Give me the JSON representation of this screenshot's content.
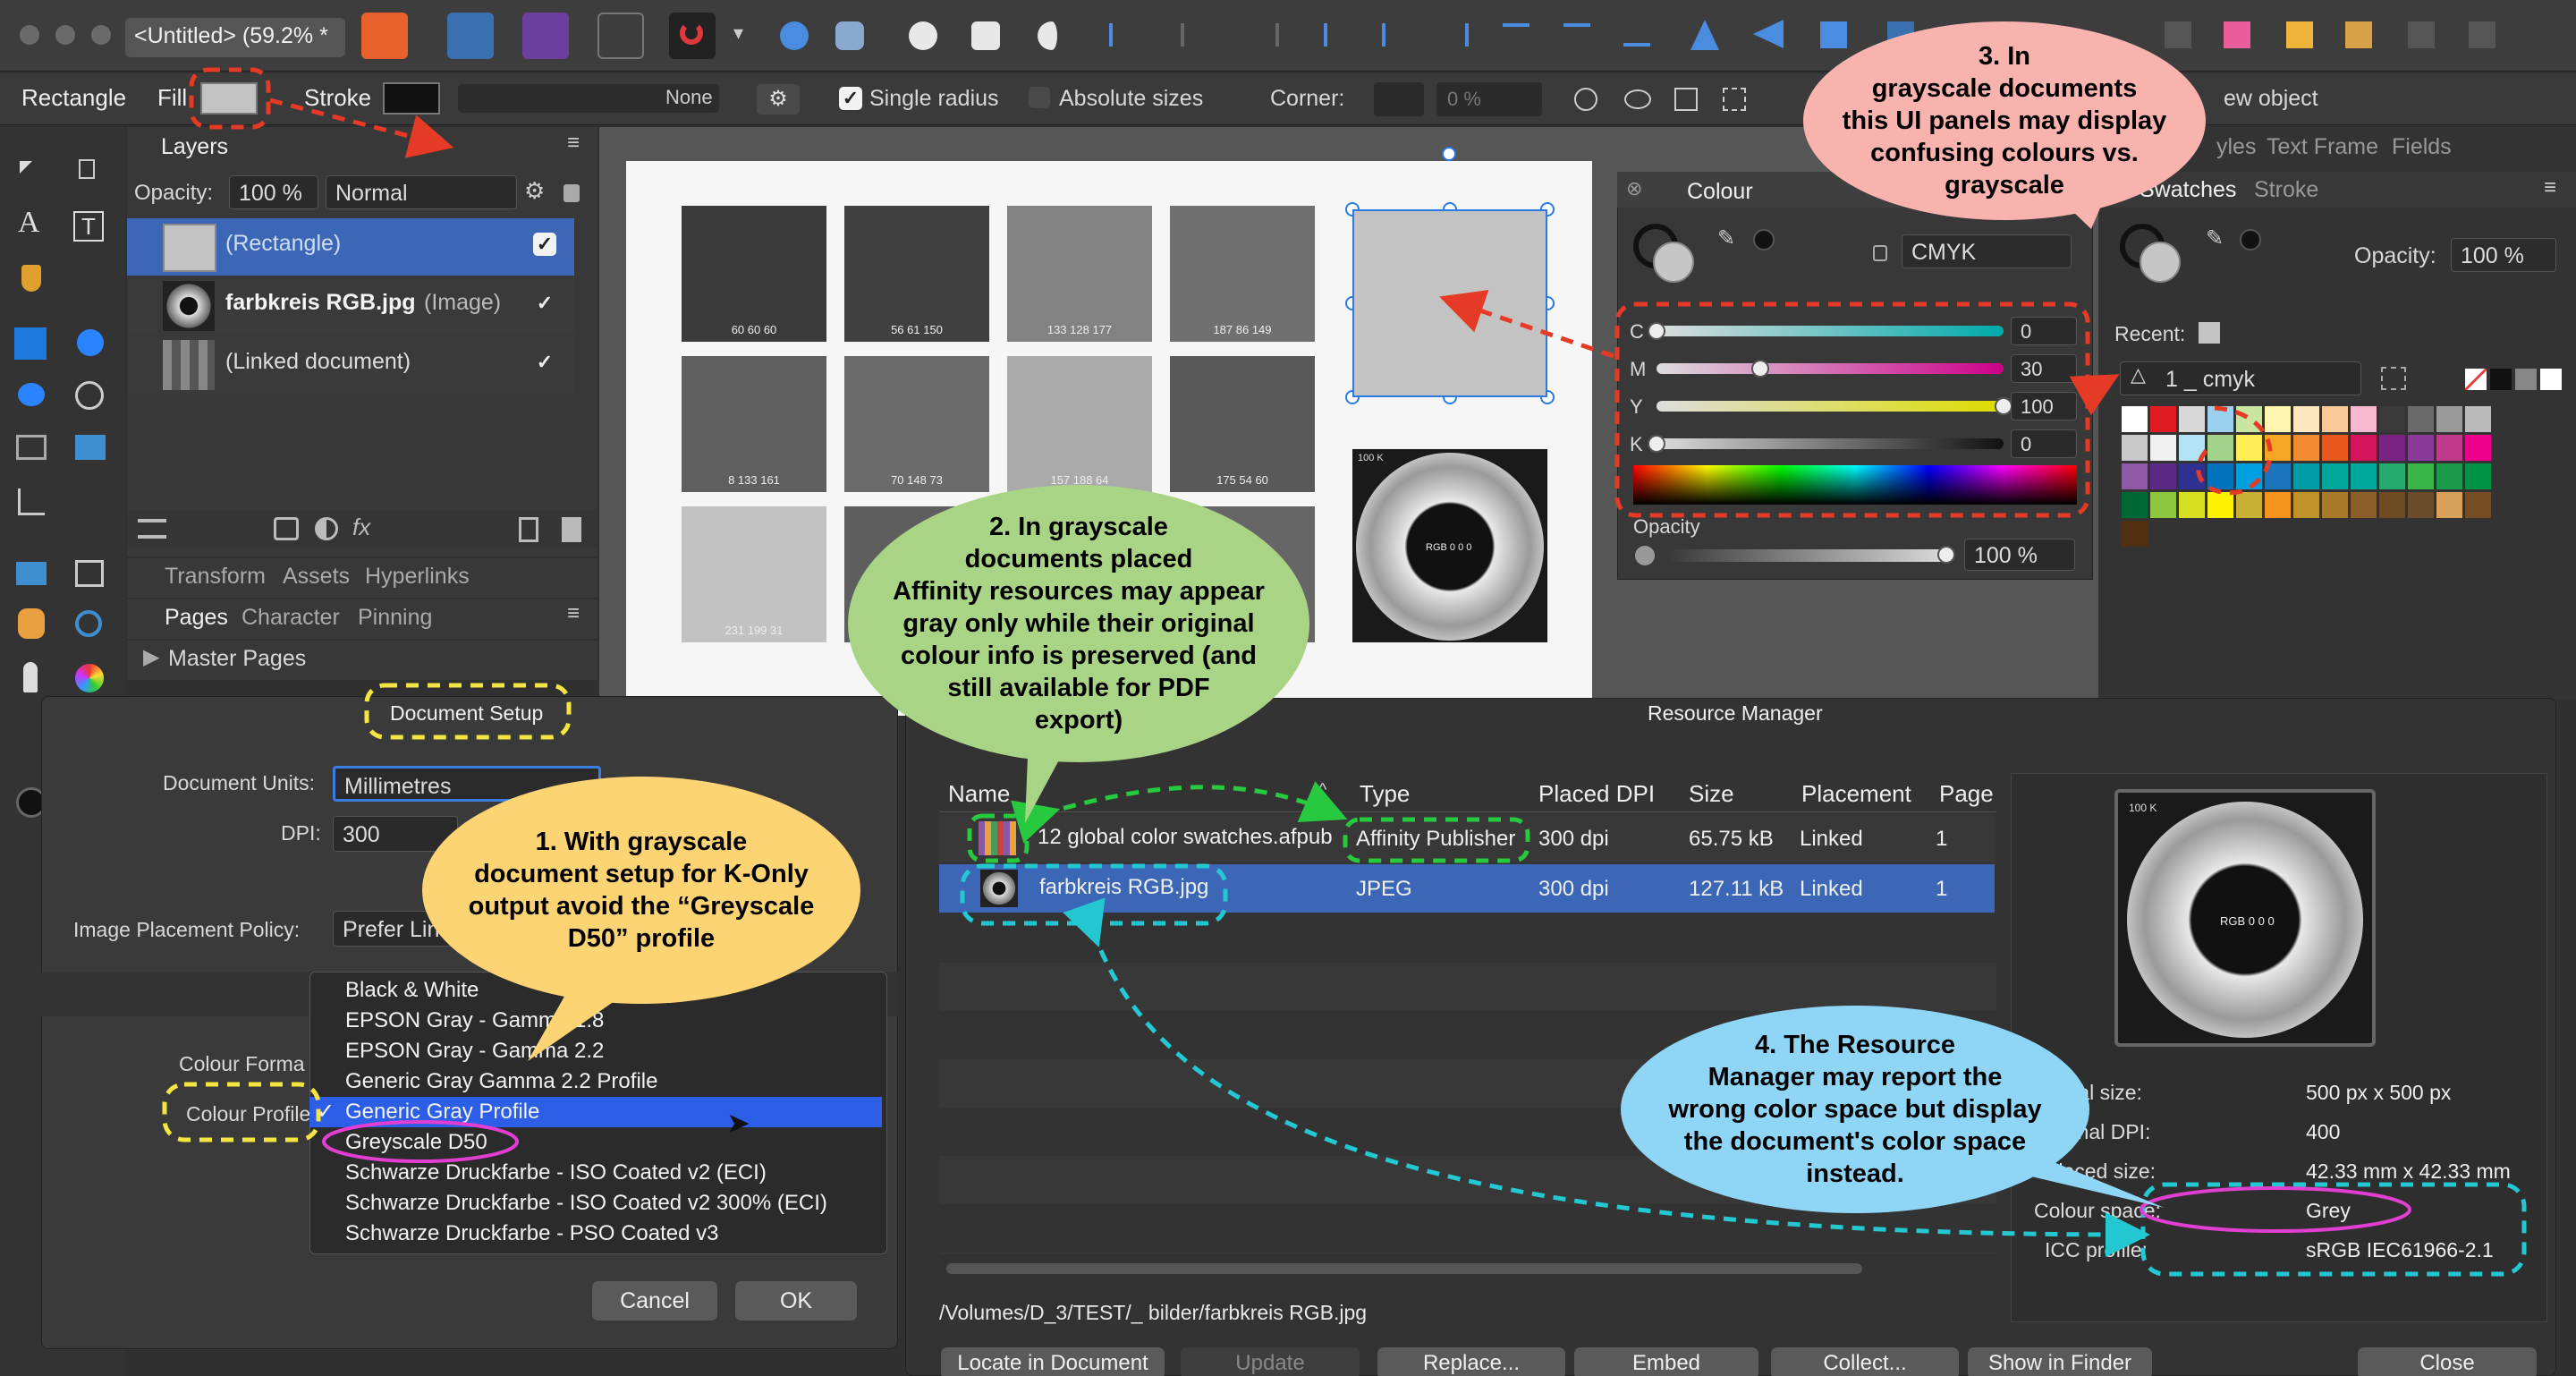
{
  "app": {
    "doc_tab": "<Untitled> (59.2% *"
  },
  "context": {
    "tool_name": "Rectangle",
    "fill_label": "Fill",
    "stroke_label": "Stroke",
    "stroke_none": "None",
    "single_radius": "Single radius",
    "absolute_sizes": "Absolute sizes",
    "corner_label": "Corner:",
    "corner_value": "0 %",
    "new_object": "ew object"
  },
  "layers": {
    "title": "Layers",
    "opacity_label": "Opacity:",
    "opacity_value": "100 %",
    "blend": "Normal",
    "items": [
      {
        "name": "(Rectangle)",
        "type": ""
      },
      {
        "name": "farbkreis RGB.jpg",
        "type": "(Image)"
      },
      {
        "name": "(Linked document)",
        "type": ""
      }
    ]
  },
  "studio": {
    "tabs1": [
      "Transform",
      "Assets",
      "Hyperlinks"
    ],
    "tabs2": [
      "Pages",
      "Character",
      "Pinning"
    ],
    "master_pages": "Master Pages",
    "right_tabs": [
      "yles",
      "Text Frame",
      "Fields"
    ]
  },
  "canvas": {
    "squares": [
      "60 60 60",
      "56 61 150",
      "133 128 177",
      "187 86 149",
      "8 133 161",
      "70 148 73",
      "157 188 64",
      "175 54 60",
      "231 199 31"
    ],
    "image_label": "100 K",
    "disc_label": "RGB 0 0 0"
  },
  "colour": {
    "title": "Colour",
    "model": "CMYK",
    "channels": [
      {
        "name": "C",
        "value": "0",
        "fraction": 0
      },
      {
        "name": "M",
        "value": "30",
        "fraction": 0.3
      },
      {
        "name": "Y",
        "value": "100",
        "fraction": 1
      },
      {
        "name": "K",
        "value": "0",
        "fraction": 0
      }
    ],
    "opacity_label": "Opacity",
    "opacity_value": "100 %"
  },
  "swatches": {
    "tabs": [
      "Swatches",
      "Stroke"
    ],
    "opacity_label": "Opacity:",
    "opacity_value": "100 %",
    "recent_label": "Recent:",
    "palette": "1 _ cmyk",
    "rows": [
      [
        "#ffffff",
        "#e11b22",
        "#d9d9d9",
        "#9bd1ee",
        "#c8e6a0",
        "#fff5b0",
        "#fde7c0",
        "#f9c99a",
        "#f7b7d0",
        "#3a3a3a",
        "#6a6a6a",
        "#9a9a9a",
        "#bbbbbb"
      ],
      [
        "#c8c8c8",
        "#f0f0f0",
        "#b3e3f5",
        "#a3d28a",
        "#ffee55",
        "#f5a623",
        "#f28b30",
        "#e8571c",
        "#d4145a",
        "#7b2382",
        "#8a3a9a",
        "#c0398a",
        "#ec008c"
      ],
      [
        "#8e5aa6",
        "#5b2a86",
        "#2e3192",
        "#0072bc",
        "#00a0e0",
        "#1b75bc",
        "#009ca6",
        "#00a79d",
        "#00a99d",
        "#25aa6f",
        "#39b54a",
        "#1a9a4a",
        "#009245"
      ],
      [
        "#006837",
        "#8dc63f",
        "#d7df23",
        "#fff200",
        "#c9b034",
        "#f7941d",
        "#c0922a",
        "#a87b2a",
        "#8b5e2a",
        "#6e4a22",
        "#6a4b2a",
        "#d8a15a",
        "#754c24"
      ],
      [
        "#503010"
      ]
    ]
  },
  "doc_setup": {
    "title": "Document Setup",
    "units_label": "Document Units:",
    "units_value": "Millimetres",
    "dpi_label": "DPI:",
    "dpi_value": "300",
    "policy_label": "Image Placement Policy:",
    "policy_value": "Prefer Lin",
    "colour_format_label": "Colour Forma",
    "colour_profile_label": "Colour Profile",
    "cancel": "Cancel",
    "ok": "OK",
    "menu": [
      "Black & White",
      "EPSON  Gray - Gamma 1.8",
      "EPSON  Gray - Gamma 2.2",
      "Generic Gray Gamma 2.2 Profile",
      "Generic Gray Profile",
      "Greyscale D50",
      "Schwarze Druckfarbe - ISO Coated v2 (ECI)",
      "Schwarze Druckfarbe - ISO Coated v2 300% (ECI)",
      "Schwarze Druckfarbe - PSO Coated v3"
    ],
    "selected": "Generic Gray Profile"
  },
  "resource": {
    "title": "Resource Manager",
    "columns": [
      "Name",
      "Type",
      "Placed DPI",
      "Size",
      "Placement",
      "Page"
    ],
    "rows": [
      {
        "name": "12 global color swatches.afpub",
        "type": "Affinity Publisher",
        "dpi": "300 dpi",
        "size": "65.75 kB",
        "placement": "Linked",
        "page": "1"
      },
      {
        "name": "farbkreis RGB.jpg",
        "type": "JPEG",
        "dpi": "300 dpi",
        "size": "127.11 kB",
        "placement": "Linked",
        "page": "1"
      }
    ],
    "path": "/Volumes/D_3/TEST/_ bilder/farbkreis RGB.jpg",
    "info": [
      {
        "k": "Original size:",
        "v": "500 px x 500 px"
      },
      {
        "k": "Original DPI:",
        "v": "400"
      },
      {
        "k": "Placed size:",
        "v": "42.33 mm x 42.33 mm"
      },
      {
        "k": "Colour space:",
        "v": "Grey"
      },
      {
        "k": "ICC profile:",
        "v": "sRGB IEC61966-2.1"
      }
    ],
    "buttons": [
      "Locate in Document",
      "Update",
      "Replace...",
      "Embed",
      "Collect...",
      "Show in Finder",
      "Close"
    ]
  },
  "callouts": {
    "c1": "1. With grayscale\ndocument setup for K-Only\noutput avoid the “Greyscale\nD50” profile",
    "c2": "2. In grayscale\ndocuments placed\nAffinity resources may appear\ngray only while their original\ncolour info is preserved (and\nstill available for PDF\nexport)",
    "c3": "3. In\ngrayscale documents\nthis UI panels may display\nconfusing colours vs.\ngrayscale",
    "c4": "4. The Resource\nManager may report the\nwrong color space but display\nthe document's color space\ninstead."
  },
  "colors": {
    "yellow_callout": "#fcd474",
    "green_callout": "#a9d486",
    "pink_callout": "#f9b3ae",
    "blue_callout": "#8fd6f6",
    "red_dash": "#e53a25",
    "green_dash": "#27c93f",
    "cyan_dash": "#24c8d3",
    "yellow_dash": "#f4e542",
    "magenta_circle": "#e23fd2",
    "selection_blue": "#2c5ee8"
  }
}
